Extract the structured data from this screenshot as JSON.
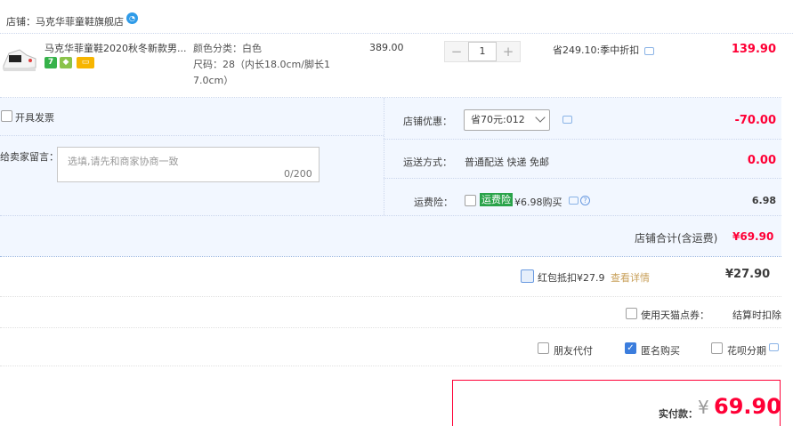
{
  "shop": {
    "label": "店铺：马克华菲童鞋旗舰店"
  },
  "item": {
    "title": "马克华菲童鞋2020秋冬新款男...",
    "color": "颜色分类：白色",
    "size_line1": "尺码：28（内长18.0cm/脚长1",
    "size_line2": "7.0cm）",
    "price": "389.00",
    "qty": "1",
    "qty_minus": "−",
    "qty_plus": "+",
    "promo": "省249.10:季中折扣",
    "subtotal": "139.90",
    "badge_7": "7"
  },
  "invoice": {
    "label": "开具发票"
  },
  "memo": {
    "label": "给卖家留言：",
    "placeholder": "选填,请先和商家协商一致",
    "count": "0/200"
  },
  "coupon": {
    "label": "店铺优惠：",
    "selected": "省70元:012",
    "value": "-70.00"
  },
  "shipping": {
    "label": "运送方式：",
    "value": "普通配送 快递 免邮",
    "amount": "0.00"
  },
  "insurance": {
    "label": "运费险：",
    "badge": "运费险",
    "text": "¥6.98购买",
    "amount": "6.98"
  },
  "shop_total": {
    "label": "店铺合计(含运费)",
    "amount": "¥69.90"
  },
  "redpacket": {
    "label": "红包抵扣¥27.9",
    "link": "查看详情",
    "amount": "¥27.90"
  },
  "tmall_points": {
    "label": "使用天猫点券：",
    "value": "结算时扣除"
  },
  "options": {
    "friend_pay": "朋友代付",
    "anonymous": "匿名购买",
    "huabei": "花呗分期"
  },
  "payment": {
    "label": "实付款：",
    "currency": "¥",
    "amount": "69.90"
  },
  "colors": {
    "accent": "#ff0036",
    "blue_bg": "#f2f7ff",
    "checkbox": "#3b7ddd"
  }
}
